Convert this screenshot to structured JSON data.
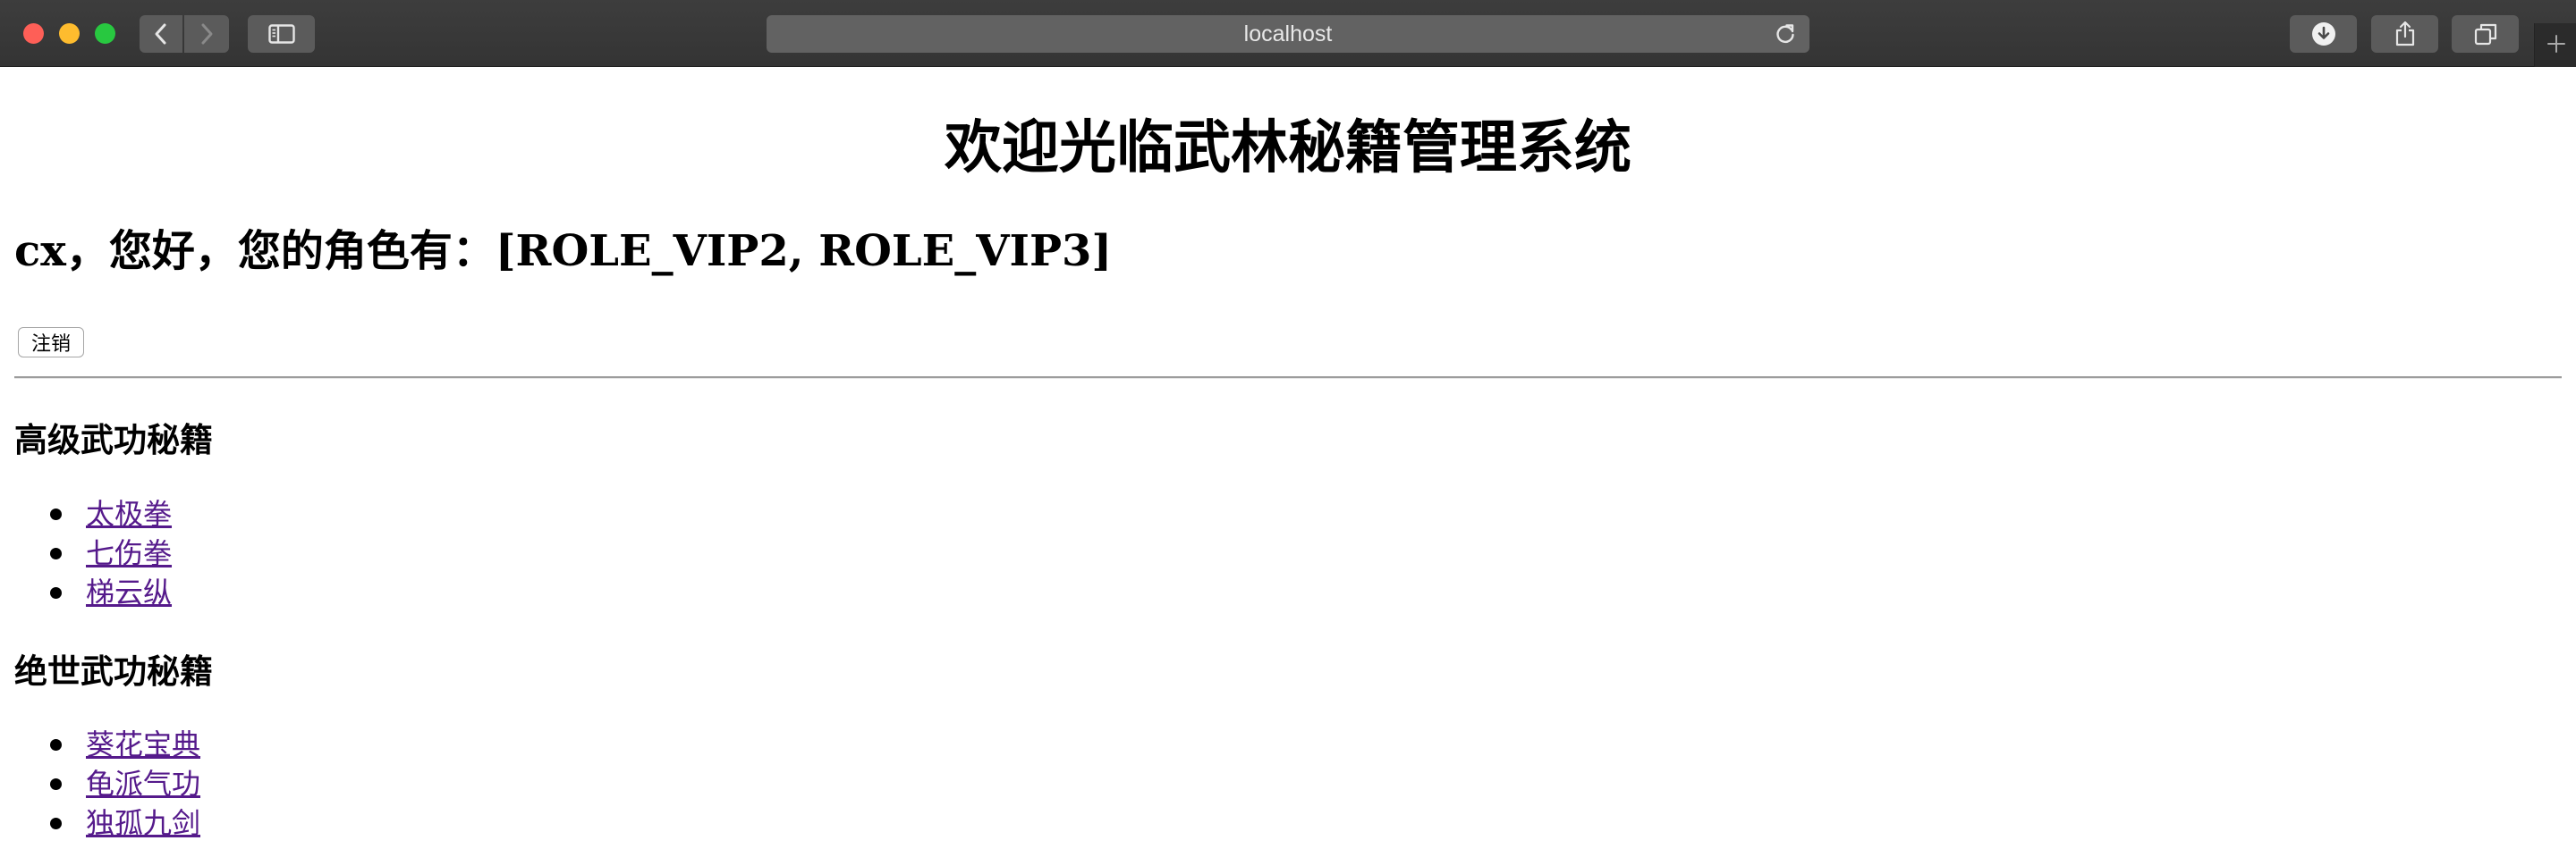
{
  "browser": {
    "address": "localhost",
    "icons": {
      "back": "chevron-left-icon",
      "forward": "chevron-right-icon",
      "sidebar": "sidebar-icon",
      "reload": "reload-icon",
      "download": "download-icon",
      "share": "share-icon",
      "tabs": "tabs-overview-icon",
      "new_tab": "plus-icon"
    },
    "colors": {
      "toolbar": "#3a3a3a",
      "address_bar": "#626262",
      "button": "#5b5b5b"
    }
  },
  "page": {
    "title": "欢迎光临武林秘籍管理系统",
    "greeting": "cx，您好，您的角色有：[ROLE_VIP2, ROLE_VIP3]",
    "logout_label": "注销",
    "sections": [
      {
        "heading": "高级武功秘籍",
        "items": [
          "太极拳",
          "七伤拳",
          "梯云纵"
        ]
      },
      {
        "heading": "绝世武功秘籍",
        "items": [
          "葵花宝典",
          "龟派气功",
          "独孤九剑"
        ]
      }
    ],
    "colors": {
      "link_visited": "#551a8b",
      "text": "#000000"
    }
  }
}
